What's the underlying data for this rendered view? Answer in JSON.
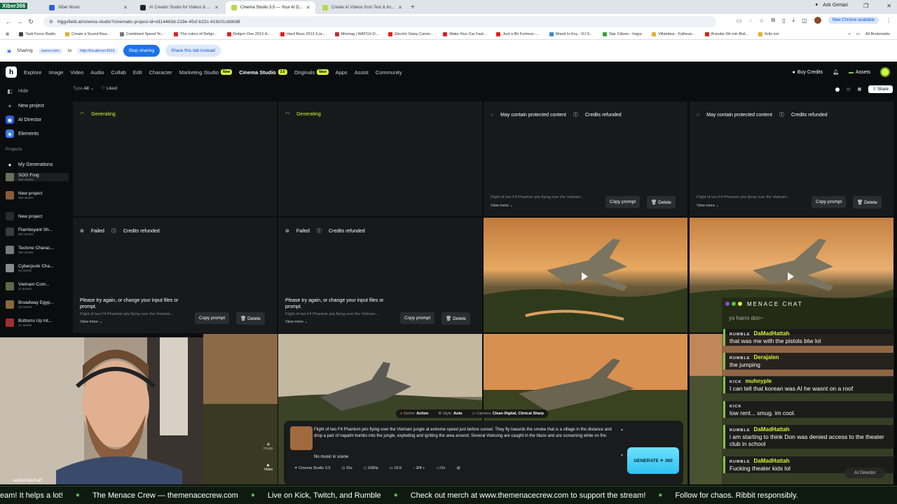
{
  "browser": {
    "tabs": [
      {
        "label": "Xiber Music",
        "color": "#2a64d9",
        "active": false
      },
      {
        "label": "AI Creator Studio for Videos & ...",
        "color": "#222222",
        "active": false
      },
      {
        "label": "Cinema Studio 3.5 — Your AI D...",
        "color": "#b6d94a",
        "active": true
      },
      {
        "label": "Create AI Videos from Text & Im...",
        "color": "#b6d94a",
        "active": false
      }
    ],
    "ask_gemini": "Ask Gemini",
    "url": "higgsfield.ai/cinema-studio?cinematic-project-id=d114463d-219e-45cf-b22c-419c01cbb0d8",
    "new_chrome": "New Chrome available",
    "bookmarks": [
      {
        "label": "Task Force Radio",
        "color": "#444444"
      },
      {
        "label": "Create a Sound Rea...",
        "color": "#e0b030"
      },
      {
        "label": "Combined Speed Te...",
        "color": "#777777"
      },
      {
        "label": "The colors of Defgo...",
        "color": "#e02020"
      },
      {
        "label": "Defgon One 2013 H...",
        "color": "#e02020"
      },
      {
        "label": "Hard Bass 2013 (Lia...",
        "color": "#e02020"
      },
      {
        "label": "Mixmag | WATCH D...",
        "color": "#c03030"
      },
      {
        "label": "Electric Daisy Carniv...",
        "color": "#e02020"
      },
      {
        "label": "Make Your Car Fast...",
        "color": "#e02020"
      },
      {
        "label": "Just a Bit Fortress -...",
        "color": "#e02020"
      },
      {
        "label": "Mixed In Key - DJ S...",
        "color": "#3a8ad9"
      },
      {
        "label": "Star Citizen - Imgur",
        "color": "#3aa040"
      },
      {
        "label": "Villalobos - Fulheue...",
        "color": "#e0b030"
      },
      {
        "label": "Bonobo 3H min Boil...",
        "color": "#e02020"
      },
      {
        "label": "Krilz.net",
        "color": "#e0b030"
      }
    ],
    "all_bookmarks": "All Bookmarks",
    "sharing_label": "Sharing",
    "sharing_chip1": "xsevo.com",
    "sharing_to": "to",
    "sharing_chip2": "http://localhost:4310",
    "stop_sharing": "Stop sharing",
    "share_this_tab": "Share this tab instead"
  },
  "nav": {
    "logo": "h",
    "items": [
      {
        "label": "Explore",
        "badge": ""
      },
      {
        "label": "Image",
        "badge": ""
      },
      {
        "label": "Video",
        "badge": ""
      },
      {
        "label": "Audio",
        "badge": ""
      },
      {
        "label": "Collab",
        "badge": ""
      },
      {
        "label": "Edit",
        "badge": ""
      },
      {
        "label": "Character",
        "badge": ""
      },
      {
        "label": "Marketing Studio",
        "badge": "New"
      },
      {
        "label": "Cinema Studio",
        "badge": "3.5"
      },
      {
        "label": "Originals",
        "badge": "New"
      },
      {
        "label": "Apps",
        "badge": ""
      },
      {
        "label": "Assist",
        "badge": ""
      },
      {
        "label": "Community",
        "badge": ""
      }
    ],
    "buy_credits": "Buy Credits",
    "assets": "Assets"
  },
  "sidebar": {
    "hide": "Hide",
    "new_project": "New project",
    "ai_director": "AI Director",
    "elements": "Elements",
    "projects_heading": "Projects",
    "my_generations": "My Generations",
    "projects": [
      {
        "name": "SOG Frog",
        "assets": "632 assets",
        "color": "#6b6e58"
      },
      {
        "name": "New project",
        "assets": "590 assets",
        "color": "#8a5a3a"
      },
      {
        "name": "New project",
        "assets": "",
        "color": "#2a2a2a"
      },
      {
        "name": "Flamboyant Sh...",
        "assets": "281 assets",
        "color": "#3a3a3a"
      },
      {
        "name": "Tectone Charac...",
        "assets": "262 assets",
        "color": "#7a7a7a"
      },
      {
        "name": "Cyberpunk Cha...",
        "assets": "63 assets",
        "color": "#8a8a8a"
      },
      {
        "name": "Vietnam Com...",
        "assets": "11 assets",
        "color": "#5a6a4a"
      },
      {
        "name": "Broadway Egyp...",
        "assets": "10 assets",
        "color": "#8a6a3a"
      },
      {
        "name": "Bottoms Up Int...",
        "assets": "41 assets",
        "color": "#a03030"
      }
    ]
  },
  "filters": {
    "type_label": "Type",
    "type_value": "All",
    "liked": "Liked",
    "share": "Share"
  },
  "cards": {
    "generating": "Generating",
    "protected": "May contain protected content",
    "refunded": "Credits refunded",
    "failed": "Failed",
    "failed_msg": "Please try again, or change your input files or prompt.",
    "prompt_snippet": "Flight of two F4 Phantom jets flying over the Vietnam...",
    "view_more": "View more",
    "copy_prompt": "Copy prompt",
    "delete": "Delete"
  },
  "composer": {
    "genre_label": "Genre:",
    "genre": "Action",
    "style_label": "Style:",
    "style": "Auto",
    "camera_label": "Camera:",
    "camera": "Clean Digital, Clinical Sharp",
    "prompt": "Flight of two F4 Phantom jets flying over the Vietnam jungle at extreme speed just before sunset. They fly towards the smoke that is a village in the distance and drop a pair of napalm bombs into the jungle, exploding and igniting the area around. Several Vietcong are caught in the blaze and are screaming while on fire.",
    "music": "No music in scene",
    "image_label": "Image",
    "video_label": "Video",
    "model": "Cinema Studio 3.5",
    "duration": "15s",
    "resolution": "1080p",
    "aspect": "16:9",
    "count": "2/4",
    "audio": "On",
    "generate": "GENERATE ✦ 360"
  },
  "webcam": {
    "name": "seldooNjemaR"
  },
  "chat": {
    "title": "MENACE CHAT",
    "partial": "yo harro don~",
    "messages": [
      {
        "platform": "RUMBLE",
        "user": "DaMadHattah",
        "text": "that was me with the pistols btw lol",
        "color": "#d7f23a"
      },
      {
        "platform": "RUMBLE",
        "user": "Derajalen",
        "text": "the jumping",
        "color": "#d7f23a"
      },
      {
        "platform": "KICK",
        "user": "muhnyple",
        "text": "I can tell that korean was AI he wasnt on a roof",
        "color": "#d7f23a"
      },
      {
        "platform": "KICK",
        "user": "",
        "text": "low rent... smug. im cool.",
        "color": "#e03030"
      },
      {
        "platform": "RUMBLE",
        "user": "DaMadHattah",
        "text": "i am starting to think Don was denied access to the theater club in school",
        "color": "#d7f23a"
      },
      {
        "platform": "RUMBLE",
        "user": "DaMadHattah",
        "text": "Fucking theater kids lol",
        "color": "#d7f23a"
      }
    ],
    "ai_director": "AI Director"
  },
  "ticker": {
    "stream_tag": "Xiber366",
    "items": [
      "eam! It helps a lot!",
      "The Menace Crew — themenacecrew.com",
      "Live on Kick, Twitch, and Rumble",
      "Check out merch at www.themenacecrew.com to support the stream!",
      "Follow for chaos. Ribbit responsibly."
    ]
  }
}
